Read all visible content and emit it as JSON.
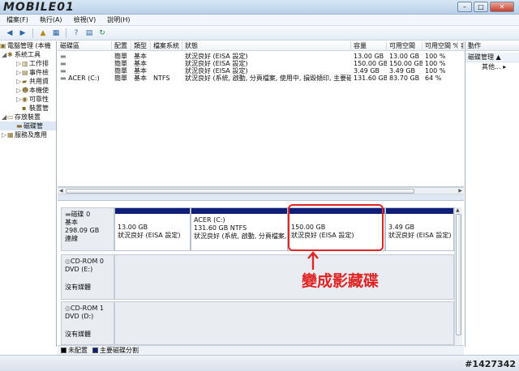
{
  "logo": "MOBILE01",
  "window_buttons": {
    "minimize": "–",
    "maximize": "□",
    "close": "✕"
  },
  "menu": [
    "檔案(F)",
    "執行(A)",
    "檢視(V)",
    "說明(H)"
  ],
  "tree": {
    "root": "電腦管理 (本機",
    "items": [
      {
        "label": "系統工具",
        "indent": 1,
        "icon": "tools-icon"
      },
      {
        "label": "工作排",
        "indent": 2,
        "icon": "task-scheduler-icon"
      },
      {
        "label": "事件檢",
        "indent": 2,
        "icon": "event-viewer-icon"
      },
      {
        "label": "共用資",
        "indent": 2,
        "icon": "shared-folders-icon"
      },
      {
        "label": "本機使",
        "indent": 2,
        "icon": "local-users-icon"
      },
      {
        "label": "可靠性",
        "indent": 2,
        "icon": "reliability-icon"
      },
      {
        "label": "裝置管",
        "indent": 2,
        "icon": "device-manager-icon"
      },
      {
        "label": "存放裝置",
        "indent": 1,
        "icon": "storage-icon"
      },
      {
        "label": "磁碟管",
        "indent": 2,
        "icon": "disk-management-icon"
      },
      {
        "label": "服務及應用",
        "indent": 1,
        "icon": "services-icon"
      }
    ]
  },
  "volume_list": {
    "headers": [
      "磁碟區",
      "配置",
      "類型",
      "檔案系統",
      "狀態",
      "容量",
      "可用空間",
      "可用空間 %",
      "容錯"
    ],
    "rows": [
      [
        "",
        "簡單",
        "基本",
        "",
        "狀況良好 (EISA 設定)",
        "13.00 GB",
        "13.00 GB",
        "100 %"
      ],
      [
        "",
        "簡單",
        "基本",
        "",
        "狀況良好 (EISA 設定)",
        "150.00 GB",
        "150.00 GB",
        "100 %"
      ],
      [
        "",
        "簡單",
        "基本",
        "",
        "狀況良好 (EISA 設定)",
        "3.49 GB",
        "3.49 GB",
        "100 %"
      ],
      [
        "ACER (C:)",
        "簡單",
        "基本",
        "NTFS",
        "狀況良好 (系統, 啟動, 分頁檔案, 使用中, 損毀傾印, 主要磁碟分割)",
        "131.60 GB",
        "83.70 GB",
        "64 %"
      ]
    ]
  },
  "disks": [
    {
      "name": "磁碟 0",
      "type": "基本",
      "size": "298.09 GB",
      "status": "連線"
    },
    {
      "name": "CD-ROM 0",
      "type": "DVD (E:)",
      "size": "",
      "status": "沒有媒體"
    },
    {
      "name": "CD-ROM 1",
      "type": "DVD (D:)",
      "size": "",
      "status": "沒有媒體"
    }
  ],
  "partitions": [
    {
      "name": "",
      "size": "13.00 GB",
      "status": "狀況良好 (EISA 設定)"
    },
    {
      "name": "ACER (C:)",
      "size": "131.60 GB NTFS",
      "status": "狀況良好 (系統, 啟動, 分頁檔案, 使用中, 損毀傾印, 主要磁碟分割)"
    },
    {
      "name": "",
      "size": "150.00 GB",
      "status": "狀況良好 (EISA 設定)"
    },
    {
      "name": "",
      "size": "3.49 GB",
      "status": "狀況良好 (EISA 設定)"
    }
  ],
  "legend": {
    "unallocated": "未配置",
    "primary": "主要磁碟分割"
  },
  "actions": {
    "header": "動作",
    "section": "磁碟管理",
    "more": "其他..."
  },
  "annotation": "變成影藏碟",
  "watermark": "#1427342",
  "colors": {
    "partition_bar": "#0f1f78",
    "annotation": "#e02525"
  }
}
